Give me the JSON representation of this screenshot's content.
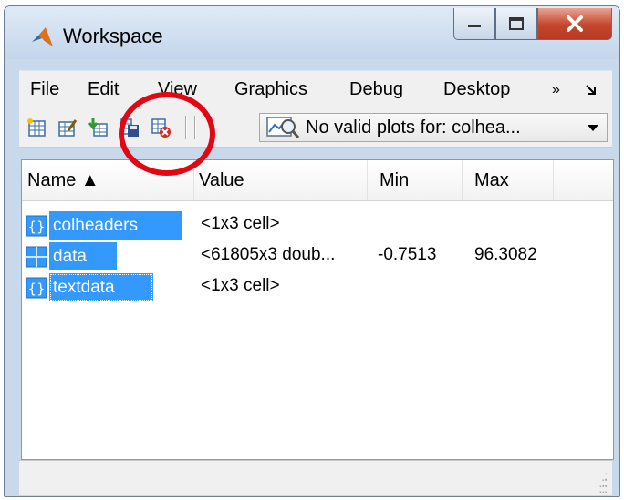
{
  "window": {
    "title": "Workspace"
  },
  "menu": [
    "File",
    "Edit",
    "View",
    "Graphics",
    "Debug",
    "Desktop",
    "»"
  ],
  "toolbar": {
    "plot_selector": "No valid plots for: colhea..."
  },
  "table": {
    "columns": [
      "Name ▲",
      "Value",
      "Min",
      "Max"
    ],
    "rows": [
      {
        "name": "colheaders",
        "value": "<1x3 cell>",
        "min": "",
        "max": "",
        "icon": "cell-array-icon"
      },
      {
        "name": "data",
        "value": "<61805x3 doub...",
        "min": "-0.7513",
        "max": "96.3082",
        "icon": "matrix-icon"
      },
      {
        "name": "textdata",
        "value": "<1x3 cell>",
        "min": "",
        "max": "",
        "icon": "cell-array-icon"
      }
    ]
  },
  "annotation": {
    "color": "#e30613"
  },
  "colors": {
    "selection": "#3399ff",
    "title_bar": "#c9d9ec",
    "close_button": "#c4452c"
  }
}
